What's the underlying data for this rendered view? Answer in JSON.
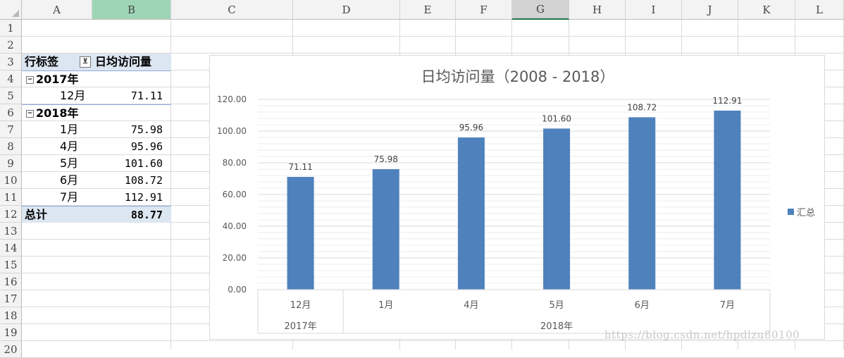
{
  "columns": [
    "A",
    "B",
    "C",
    "D",
    "E",
    "F",
    "G",
    "H",
    "I",
    "J",
    "K",
    "L"
  ],
  "rows": [
    "1",
    "2",
    "3",
    "4",
    "5",
    "6",
    "7",
    "8",
    "9",
    "10",
    "11",
    "12",
    "13",
    "14",
    "15",
    "16",
    "17",
    "18",
    "19",
    "20"
  ],
  "pivot": {
    "header_row_label": "行标签",
    "header_value_label": "日均访问量",
    "groups": [
      {
        "label": "2017年",
        "items": [
          {
            "month": "12月",
            "value": "71.11"
          }
        ]
      },
      {
        "label": "2018年",
        "items": [
          {
            "month": "1月",
            "value": "75.98"
          },
          {
            "month": "4月",
            "value": "95.96"
          },
          {
            "month": "5月",
            "value": "101.60"
          },
          {
            "month": "6月",
            "value": "108.72"
          },
          {
            "month": "7月",
            "value": "112.91"
          }
        ]
      }
    ],
    "total_label": "总计",
    "total_value": "88.77"
  },
  "chart_data": {
    "type": "bar",
    "title": "日均访问量（2008 - 2018）",
    "categories": [
      "12月",
      "1月",
      "4月",
      "5月",
      "6月",
      "7月"
    ],
    "category_groups": [
      {
        "label": "2017年",
        "count": 1
      },
      {
        "label": "2018年",
        "count": 5
      }
    ],
    "series": [
      {
        "name": "汇总",
        "values": [
          71.11,
          75.98,
          95.96,
          101.6,
          108.72,
          112.91
        ]
      }
    ],
    "data_labels": [
      "71.11",
      "75.98",
      "95.96",
      "101.60",
      "108.72",
      "112.91"
    ],
    "y_ticks": [
      "0.00",
      "20.00",
      "40.00",
      "60.00",
      "80.00",
      "100.00",
      "120.00"
    ],
    "ylim": [
      0,
      120
    ],
    "grid": true,
    "legend_position": "right",
    "bar_color": "#4f81bd"
  },
  "watermark": "https://blog.csdn.net/hpdlzu80100"
}
